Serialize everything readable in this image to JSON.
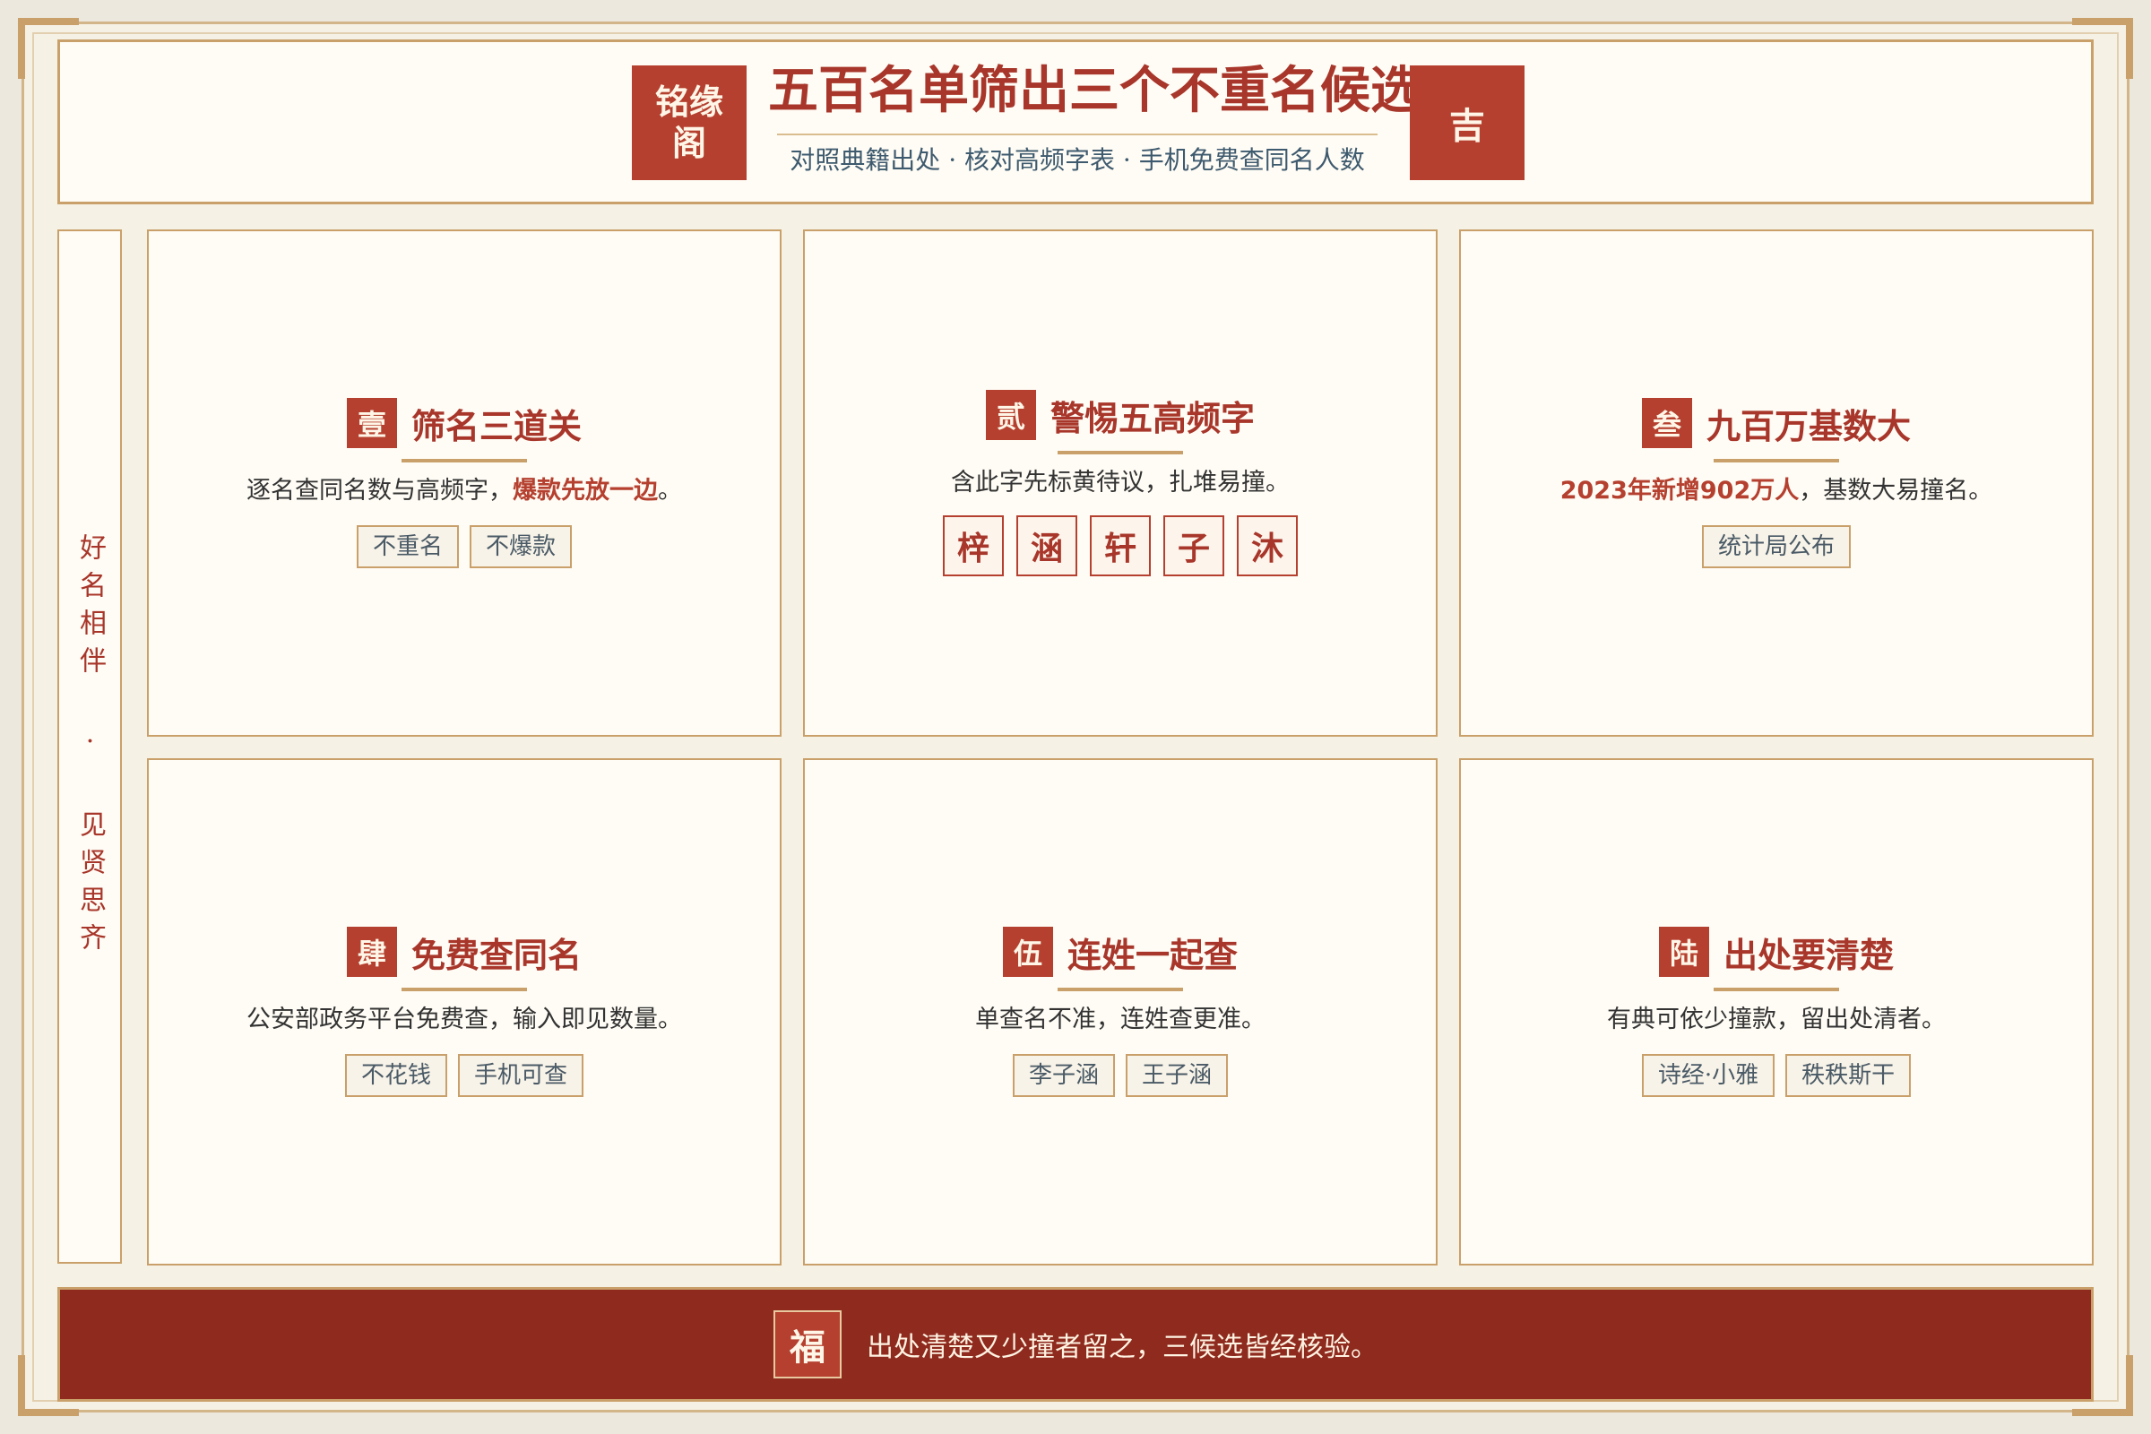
{
  "header": {
    "logo": "铭缘阁",
    "title": "五百名单筛出三个不重名候选",
    "subtitle": "对照典籍出处 · 核对高频字表 · 手机免费查同名人数",
    "seal": "吉"
  },
  "side": {
    "text": "好名相伴 · 见贤思齐"
  },
  "cards": [
    {
      "num": "壹",
      "title": "筛名三道关",
      "desc": "逐名查同名数与高频字，",
      "highlight": "爆款先放一边",
      "desc_end": "。",
      "tags": [
        "不重名",
        "不爆款"
      ]
    },
    {
      "num": "贰",
      "title": "警惕五高频字",
      "desc": "含此字先标黄待议，扎堆易撞。",
      "chars": [
        "梓",
        "涵",
        "轩",
        "子",
        "沐"
      ]
    },
    {
      "num": "叁",
      "title": "九百万基数大",
      "highlight": "2023年新增902万人",
      "desc": "，基数大易撞名。",
      "tags": [
        "统计局公布"
      ]
    },
    {
      "num": "肆",
      "title": "免费查同名",
      "desc": "公安部政务平台免费查，输入即见数量。",
      "tags": [
        "不花钱",
        "手机可查"
      ]
    },
    {
      "num": "伍",
      "title": "连姓一起查",
      "desc": "单查名不准，连姓查更准。",
      "tags": [
        "李子涵",
        "王子涵"
      ]
    },
    {
      "num": "陆",
      "title": "出处要清楚",
      "desc": "有典可依少撞款，留出处清者。",
      "tags": [
        "诗经·小雅",
        "秩秩斯干"
      ]
    }
  ],
  "footer": {
    "seal": "福",
    "text": "出处清楚又少撞者留之，三候选皆经核验。"
  },
  "colors": {
    "accent": "#b5402f",
    "title_red": "#a8362a",
    "gold": "#c9a06a",
    "footer_bg": "#8e2a1e",
    "paper": "#fffcf5"
  }
}
